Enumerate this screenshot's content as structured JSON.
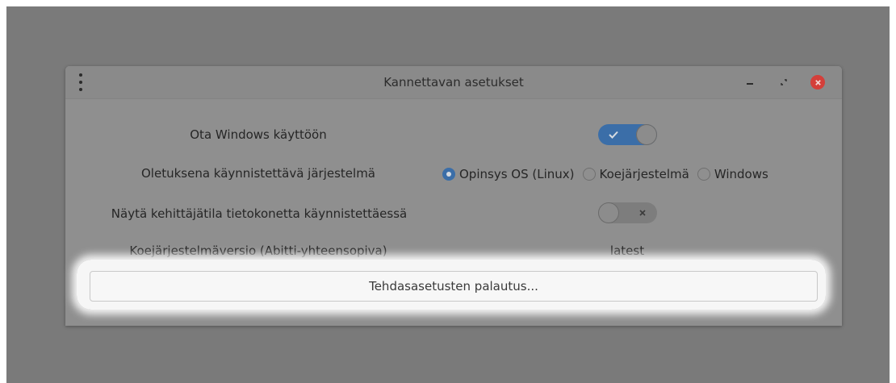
{
  "window": {
    "title": "Kannettavan asetukset",
    "icons": {
      "menu": "vertical-dots-icon",
      "minimize": "minimize-icon",
      "maximize": "maximize-icon",
      "close": "close-icon"
    }
  },
  "settings": {
    "enable_windows": {
      "label": "Ota Windows käyttöön",
      "state": true
    },
    "default_os": {
      "label": "Oletuksena käynnistettävä järjestelmä",
      "options": [
        "Opinsys OS (Linux)",
        "Koejärjestelmä",
        "Windows"
      ],
      "selected": "Opinsys OS (Linux)"
    },
    "developer_mode": {
      "label": "Näytä kehittäjätila tietokonetta käynnistettäessä",
      "state": false
    },
    "exam_version": {
      "label": "Koejärjestelmäversio (Abitti-yhteensopiva)",
      "value": "latest"
    }
  },
  "reset_button": {
    "label": "Tehdasasetusten palautus..."
  },
  "colors": {
    "accent": "#3b6ea8",
    "close": "#d43f3a",
    "backdrop": "#7a7a7a",
    "window": "#8f8f8f"
  }
}
